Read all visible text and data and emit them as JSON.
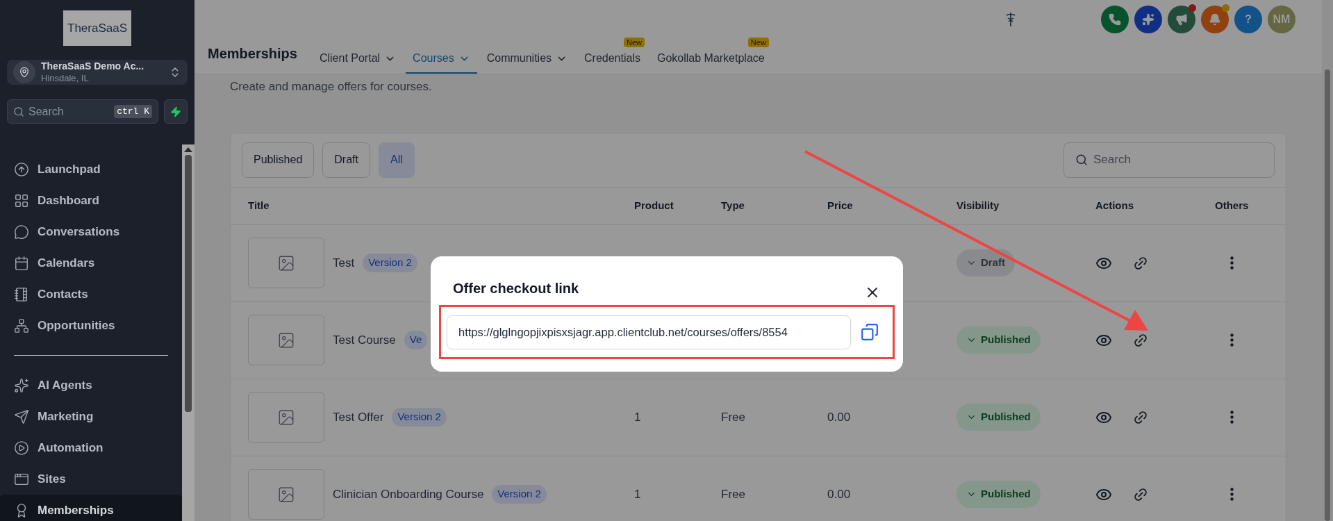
{
  "sidebar": {
    "logo": "TheraSaaS",
    "account": {
      "name": "TheraSaaS Demo Ac...",
      "location": "Hinsdale, IL"
    },
    "search": {
      "placeholder": "Search",
      "shortcut": "ctrl K"
    },
    "nav_groups": [
      [
        {
          "label": "Launchpad",
          "selected": false
        },
        {
          "label": "Dashboard",
          "selected": false
        },
        {
          "label": "Conversations",
          "selected": false
        },
        {
          "label": "Calendars",
          "selected": false
        },
        {
          "label": "Contacts",
          "selected": false
        },
        {
          "label": "Opportunities",
          "selected": false
        }
      ],
      [
        {
          "label": "AI Agents",
          "selected": false
        },
        {
          "label": "Marketing",
          "selected": false
        },
        {
          "label": "Automation",
          "selected": false
        },
        {
          "label": "Sites",
          "selected": false
        },
        {
          "label": "Memberships",
          "selected": true
        }
      ]
    ]
  },
  "header": {
    "title": "Memberships",
    "tabs": [
      {
        "label": "Client Portal",
        "selected": false,
        "dropdown": true
      },
      {
        "label": "Courses",
        "selected": true,
        "dropdown": true
      },
      {
        "label": "Communities",
        "selected": false,
        "dropdown": true
      },
      {
        "label": "Credentials",
        "selected": false,
        "dropdown": false,
        "badge": "New"
      },
      {
        "label": "Gokollab Marketplace",
        "selected": false,
        "dropdown": false,
        "badge": "New"
      }
    ],
    "actions": [
      {
        "kind": "phone",
        "color": "#07532e"
      },
      {
        "kind": "sparkle",
        "color": "#112f82"
      },
      {
        "kind": "megaphone",
        "color": "#234b39",
        "notification_dot": {
          "color": "#841717"
        }
      },
      {
        "kind": "bell",
        "color": "#8f4110",
        "notification_dot": {
          "color": "#8c6b05"
        }
      },
      {
        "kind": "help",
        "color": "#125289",
        "label": "?"
      },
      {
        "kind": "avatar",
        "color": "#646742",
        "label": "NM"
      }
    ]
  },
  "page": {
    "subtitle": "Create and manage offers for courses.",
    "filters": [
      {
        "label": "Published",
        "selected": false
      },
      {
        "label": "Draft",
        "selected": false
      },
      {
        "label": "All",
        "selected": true
      }
    ],
    "search": {
      "placeholder": "Search"
    },
    "columns": [
      "Title",
      "Product",
      "Type",
      "Price",
      "Visibility",
      "Actions",
      "Others"
    ],
    "rows": [
      {
        "title": "Test",
        "badge": "Version 2",
        "visibility": {
          "label": "Draft",
          "kind": "draft"
        }
      },
      {
        "title": "Test Course",
        "badge": "Ve",
        "visibility": {
          "label": "Published",
          "kind": "published"
        }
      },
      {
        "title": "Test Offer",
        "badge": "Version 2",
        "product": "1",
        "type": "Free",
        "price": "0.00",
        "visibility": {
          "label": "Published",
          "kind": "published"
        }
      },
      {
        "title": "Clinician Onboarding Course",
        "badge": "Version 2",
        "product": "1",
        "type": "Free",
        "price": "0.00",
        "visibility": {
          "label": "Published",
          "kind": "published"
        }
      }
    ]
  },
  "modal": {
    "title": "Offer checkout link",
    "url": "https://glglngopjixpisxsjagr.app.clientclub.net/courses/offers/8554"
  }
}
